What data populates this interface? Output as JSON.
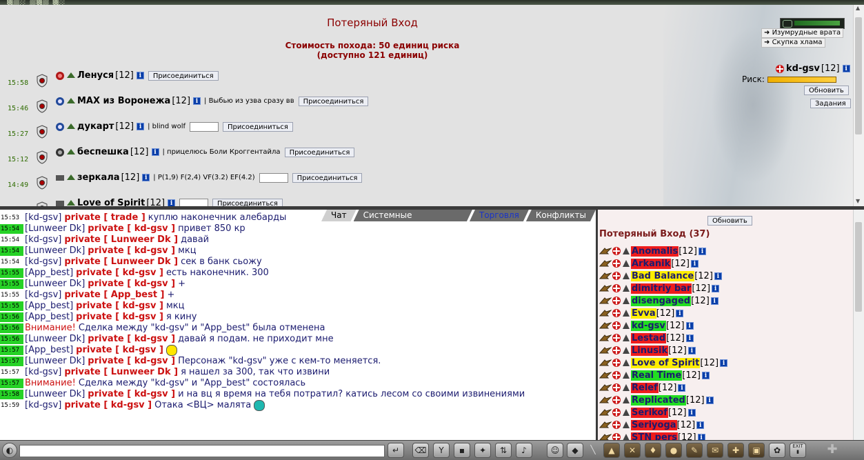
{
  "header": {
    "logo_text": ""
  },
  "location": {
    "title": "Потеряный Вход",
    "cost_line1": "Стоимость похода: 50 единиц риска",
    "cost_line2": "(доступно 121 единиц)"
  },
  "groups": [
    {
      "time": "15:58",
      "name": "Ленуся",
      "level": "[12]",
      "note": "",
      "has_input": false,
      "join": "Присоединиться"
    },
    {
      "time": "15:46",
      "name": "MAX из Воронежа",
      "level": "[12]",
      "note": "| Выбью из узва сразу вв",
      "has_input": false,
      "join": "Присоединиться"
    },
    {
      "time": "15:27",
      "name": "дукарт",
      "level": "[12]",
      "note": "| blind wolf",
      "has_input": true,
      "join": "Присоединиться"
    },
    {
      "time": "15:12",
      "name": "беспешка",
      "level": "[12]",
      "note": "| прицелюсь Боли Кроггентайла",
      "has_input": false,
      "join": "Присоединиться"
    },
    {
      "time": "14:49",
      "name": "зеркала",
      "level": "[12]",
      "note": "| P(1,9) F(2,4) VF(3.2) EF(4.2)",
      "has_input": true,
      "join": "Присоединиться"
    },
    {
      "time": "",
      "name": "Love of Spirit",
      "level": "[12]",
      "note": "",
      "has_input": true,
      "join": "Присоединиться"
    }
  ],
  "side": {
    "links": [
      "Изумрудные врата",
      "Скупка хлама"
    ],
    "player_name": "kd-gsv",
    "player_level": "[12]",
    "risk_label": "Риск:",
    "risk_fraction": 1.0,
    "refresh": "Обновить",
    "tasks": "Задания"
  },
  "chat": {
    "tabs": [
      "Чат",
      "Системные сообщения",
      "Торговля",
      "Конфликты"
    ],
    "messages": [
      {
        "time": "15:53",
        "hl": false,
        "who": "[kd-gsv]",
        "priv": "private [ trade ]",
        "text": "куплю наконечник алебарды"
      },
      {
        "time": "15:54",
        "hl": true,
        "who": "[Lunweer Dk]",
        "priv": "private [ kd-gsv ]",
        "text": "привет 850 кр"
      },
      {
        "time": "15:54",
        "hl": false,
        "who": "[kd-gsv]",
        "priv": "private [ Lunweer Dk ]",
        "text": "давай"
      },
      {
        "time": "15:54",
        "hl": true,
        "who": "[Lunweer Dk]",
        "priv": "private [ kd-gsv ]",
        "text": "мкц"
      },
      {
        "time": "15:54",
        "hl": false,
        "who": "[kd-gsv]",
        "priv": "private [ Lunweer Dk ]",
        "text": "сек в банк сьожу"
      },
      {
        "time": "15:55",
        "hl": true,
        "who": "[App_best]",
        "priv": "private [ kd-gsv ]",
        "text": "есть наконечник. 300"
      },
      {
        "time": "15:55",
        "hl": true,
        "who": "[Lunweer Dk]",
        "priv": "private [ kd-gsv ]",
        "text": "+"
      },
      {
        "time": "15:55",
        "hl": false,
        "who": "[kd-gsv]",
        "priv": "private [ App_best ]",
        "text": "+"
      },
      {
        "time": "15:55",
        "hl": true,
        "who": "[App_best]",
        "priv": "private [ kd-gsv ]",
        "text": "мкц"
      },
      {
        "time": "15:56",
        "hl": true,
        "who": "[App_best]",
        "priv": "private [ kd-gsv ]",
        "text": "я кину"
      },
      {
        "time": "15:56",
        "hl": true,
        "warn": "Внимание!",
        "text": "Сделка между \"kd-gsv\" и \"App_best\" была отменена"
      },
      {
        "time": "15:56",
        "hl": true,
        "who": "[Lunweer Dk]",
        "priv": "private [ kd-gsv ]",
        "text": "давай я подам. не приходит мне"
      },
      {
        "time": "15:57",
        "hl": true,
        "who": "[App_best]",
        "priv": "private [ kd-gsv ]",
        "text": "",
        "smile": "yellow"
      },
      {
        "time": "15:57",
        "hl": true,
        "who": "[Lunweer Dk]",
        "priv": "private [ kd-gsv ]",
        "text": "Персонаж \"kd-gsv\" уже с кем-то меняется."
      },
      {
        "time": "15:57",
        "hl": false,
        "who": "[kd-gsv]",
        "priv": "private [ Lunweer Dk ]",
        "text": "я нашел за 300, так что извини"
      },
      {
        "time": "15:57",
        "hl": true,
        "warn": "Внимание!",
        "text": "Сделка между \"kd-gsv\" и \"App_best\" состоялась"
      },
      {
        "time": "15:58",
        "hl": true,
        "who": "[Lunweer Dk]",
        "priv": "private [ kd-gsv ]",
        "text": "и на вц я время на тебя потратил? катись лесом со своими извинениями"
      },
      {
        "time": "15:59",
        "hl": false,
        "who": "[kd-gsv]",
        "priv": "private [ kd-gsv ]",
        "text": "Отака <ВЦ> малята",
        "smile": "teal"
      }
    ],
    "input_value": ""
  },
  "people": {
    "refresh": "Обновить",
    "title": "Потеряный Вход (37)",
    "list": [
      {
        "name": "Anomalis",
        "level": "[12]",
        "bg": "red"
      },
      {
        "name": "Arkanik",
        "level": "[12]",
        "bg": "red"
      },
      {
        "name": "Bad Balance",
        "level": "[12]",
        "bg": "yellow"
      },
      {
        "name": "dimitriy bar",
        "level": "[12]",
        "bg": "red"
      },
      {
        "name": "disengaged",
        "level": "[12]",
        "bg": "green"
      },
      {
        "name": "Evva",
        "level": "[12]",
        "bg": "yellow"
      },
      {
        "name": "kd-gsv",
        "level": "[12]",
        "bg": "green"
      },
      {
        "name": "Lestad",
        "level": "[12]",
        "bg": "red"
      },
      {
        "name": "Linusik",
        "level": "[12]",
        "bg": "red"
      },
      {
        "name": "Love of Spirit",
        "level": "[12]",
        "bg": "yellow"
      },
      {
        "name": "Real Time",
        "level": "[12]",
        "bg": "green"
      },
      {
        "name": "Relef",
        "level": "[12]",
        "bg": "red"
      },
      {
        "name": "Replicated",
        "level": "[12]",
        "bg": "green"
      },
      {
        "name": "Serikof",
        "level": "[12]",
        "bg": "red"
      },
      {
        "name": "Seriyoga",
        "level": "[12]",
        "bg": "red"
      },
      {
        "name": "STN pers",
        "level": "[12]",
        "bg": "red"
      }
    ]
  },
  "colors": {
    "red_bg": "#ee1c1c",
    "yellow_bg": "#ffee00",
    "green_bg": "#22dd22",
    "title_red": "#8b0000"
  }
}
